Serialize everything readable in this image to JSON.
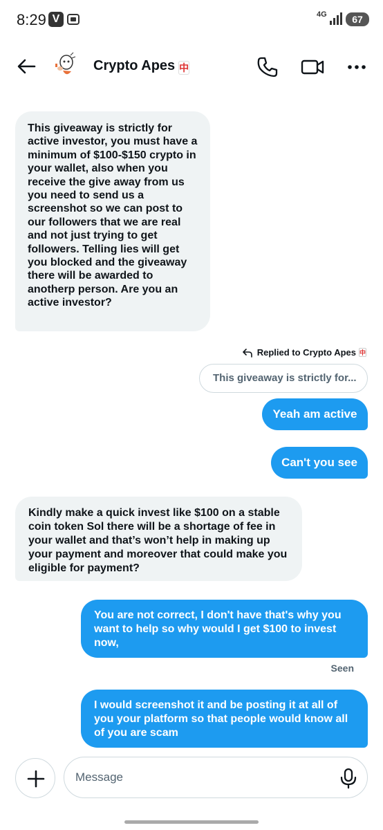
{
  "status_bar": {
    "time": "8:29",
    "app_icon_letter": "V",
    "network": "4G",
    "battery": "67"
  },
  "header": {
    "title": "Crypto Apes",
    "title_emoji": "中"
  },
  "messages": [
    {
      "direction": "incoming",
      "text": "This giveaway is strictly for active investor, you must have a minimum of $100-$150 crypto in your wallet, also when you receive the give away from us you need to send us a screenshot so we can post to our followers that we are real and not just trying to get followers. Telling lies will get you blocked and the giveaway there will be awarded to anotherp person. Are you an active investor?"
    },
    {
      "direction": "outgoing",
      "reply_label": "Replied to Crypto Apes",
      "reply_emoji": "中",
      "quoted_text": "This giveaway is strictly for...",
      "text": "Yeah am active"
    },
    {
      "direction": "outgoing",
      "text": "Can't you see"
    },
    {
      "direction": "incoming",
      "text": "Kindly make a quick invest like $100 on a stable coin token Sol there will be a shortage of fee in your wallet and  that’s won’t help in making up your payment and moreover that could make you eligible for payment?"
    },
    {
      "direction": "outgoing",
      "text": "You are not correct, I don't have that's why you want to help so why would I get $100  to invest now,",
      "status": "Seen"
    },
    {
      "direction": "outgoing",
      "text": "I would screenshot it and be posting it at all of you your platform so that people would know all of you are scam"
    }
  ],
  "composer": {
    "placeholder": "Message"
  },
  "colors": {
    "accent": "#1d9bf0",
    "incoming_bubble": "#eff3f4",
    "text_primary": "#0f1419",
    "text_secondary": "#536471"
  },
  "icons": [
    "back-arrow-icon",
    "phone-icon",
    "video-camera-icon",
    "more-horizontal-icon",
    "plus-icon",
    "microphone-icon",
    "reply-arrow-icon"
  ]
}
